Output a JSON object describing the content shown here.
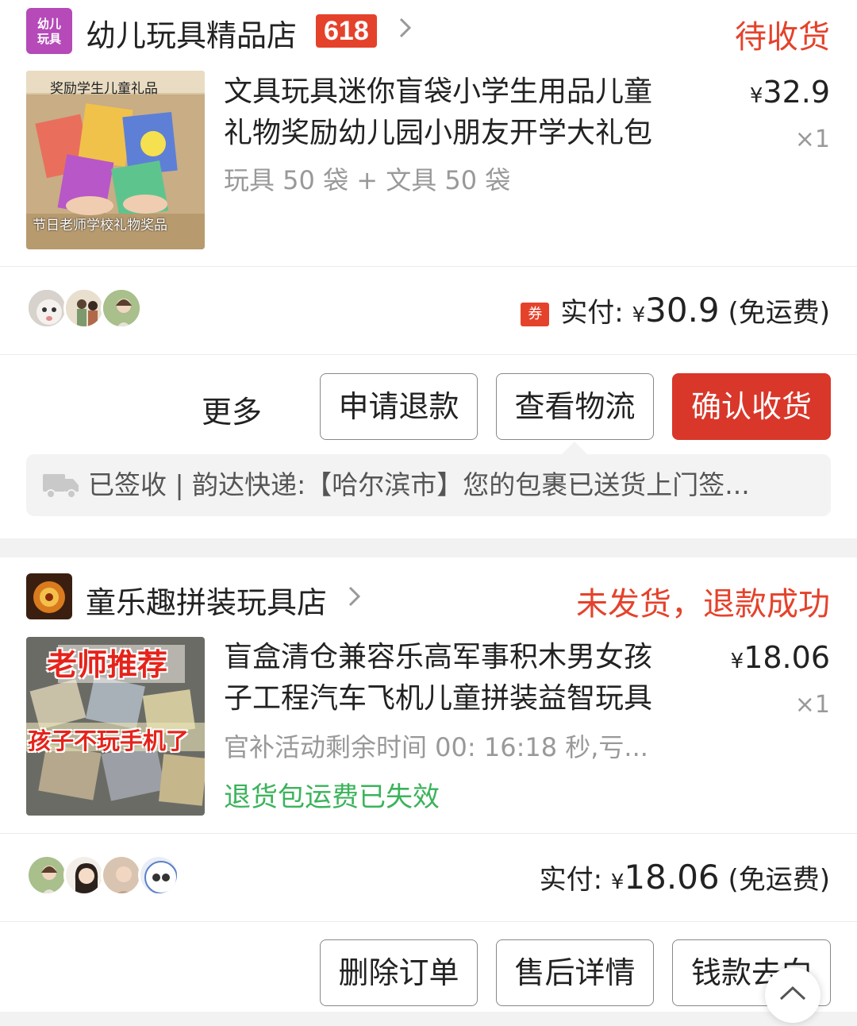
{
  "orders": [
    {
      "shop_logo_text": "幼儿\n玩具",
      "shop_name": "幼儿玩具精品店",
      "badge": "618",
      "status": "待收货",
      "product": {
        "image_top_caption": "奖励学生儿童礼品",
        "image_bottom_caption": "节日老师学校礼物奖品",
        "title_line1": "文具玩具迷你盲袋小学生用品儿童",
        "title_line2": "礼物奖励幼儿园小朋友开学大礼包",
        "spec": "玩具 50 袋 + 文具 50 袋",
        "currency": "¥",
        "price": "32.9",
        "qty": "×1"
      },
      "coupon": "券",
      "paid_label": "实付:",
      "paid_currency": "¥",
      "paid_amount": "30.9",
      "shipping_note": "(免运费)",
      "buttons": {
        "more": "更多",
        "refund": "申请退款",
        "logistics": "查看物流",
        "confirm": "确认收货"
      },
      "logistics_text": "已签收 | 韵达快递:【哈尔滨市】您的包裹已送货上门签..."
    },
    {
      "shop_name": "童乐趣拼装玩具店",
      "status": "未发货，退款成功",
      "product": {
        "image_top_caption": "老师推荐",
        "image_mid_caption": "孩子不玩手机了",
        "title_line1": "盲盒清仓兼容乐高军事积木男女孩",
        "title_line2": "子工程汽车飞机儿童拼装益智玩具",
        "spec": "官补活动剩余时间 00: 16:18 秒,亏...",
        "return_note": "退货包运费已失效",
        "currency": "¥",
        "price": "18.06",
        "qty": "×1"
      },
      "paid_label": "实付:",
      "paid_currency": "¥",
      "paid_amount": "18.06",
      "shipping_note": "(免运费)",
      "buttons": {
        "delete": "删除订单",
        "aftersale": "售后详情",
        "money_flow": "钱款去向"
      }
    }
  ],
  "colors": {
    "accent": "#e5422b",
    "green": "#3bb35b",
    "muted": "#999999"
  }
}
